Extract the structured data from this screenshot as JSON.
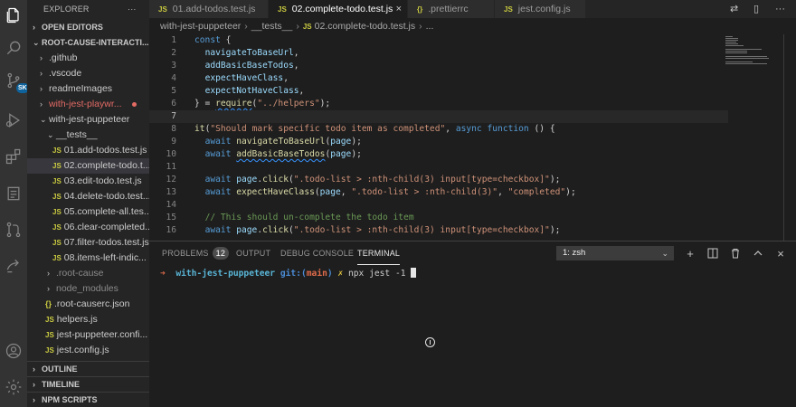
{
  "sidebar": {
    "title": "EXPLORER",
    "title_menu": "···",
    "open_editors": "OPEN EDITORS",
    "root": "ROOT-CAUSE-INTERACTI...",
    "items": [
      {
        "label": ".github",
        "kind": "folder"
      },
      {
        "label": ".vscode",
        "kind": "folder"
      },
      {
        "label": "readmeImages",
        "kind": "folder"
      },
      {
        "label": "with-jest-playwr...",
        "kind": "folder"
      },
      {
        "label": "with-jest-puppeteer",
        "kind": "folder-open"
      },
      {
        "label": "__tests__",
        "kind": "folder-open"
      },
      {
        "label": "01.add-todos.test.js",
        "kind": "js"
      },
      {
        "label": "02.complete-todo.t...",
        "kind": "js"
      },
      {
        "label": "03.edit-todo.test.js",
        "kind": "js"
      },
      {
        "label": "04.delete-todo.test...",
        "kind": "js"
      },
      {
        "label": "05.complete-all.tes...",
        "kind": "js"
      },
      {
        "label": "06.clear-completed...",
        "kind": "js"
      },
      {
        "label": "07.filter-todos.test.js",
        "kind": "js"
      },
      {
        "label": "08.items-left-indic...",
        "kind": "js"
      },
      {
        "label": ".root-cause",
        "kind": "folder"
      },
      {
        "label": "node_modules",
        "kind": "folder"
      },
      {
        "label": ".root-causerc.json",
        "kind": "json"
      },
      {
        "label": "helpers.js",
        "kind": "js"
      },
      {
        "label": "jest-puppeteer.confi...",
        "kind": "js"
      },
      {
        "label": "jest.config.js",
        "kind": "js"
      }
    ],
    "outline": "OUTLINE",
    "timeline": "TIMELINE",
    "npm_scripts": "NPM SCRIPTS"
  },
  "tabs": [
    {
      "label": "01.add-todos.test.js",
      "icon": "JS"
    },
    {
      "label": "02.complete-todo.test.js",
      "icon": "JS"
    },
    {
      "label": ".prettierrc",
      "icon": "{}"
    },
    {
      "label": "jest.config.js",
      "icon": "JS"
    }
  ],
  "tab_close": "×",
  "breadcrumb": {
    "folder1": "with-jest-puppeteer",
    "folder2": "__tests__",
    "file_icon": "JS",
    "file": "02.complete-todo.test.js",
    "tail": "..."
  },
  "editor_lines": [
    {
      "n": "1"
    },
    {
      "n": "2"
    },
    {
      "n": "3"
    },
    {
      "n": "4"
    },
    {
      "n": "5"
    },
    {
      "n": "6"
    },
    {
      "n": "7"
    },
    {
      "n": "8"
    },
    {
      "n": "9"
    },
    {
      "n": "10"
    },
    {
      "n": "11"
    },
    {
      "n": "12"
    },
    {
      "n": "13"
    },
    {
      "n": "14"
    },
    {
      "n": "15"
    },
    {
      "n": "16"
    }
  ],
  "code": {
    "l1_kw": "const",
    "l1_rest": " {",
    "l2": "navigateToBaseUrl",
    "l3": "addBasicBaseTodos",
    "l4": "expectHaveClass",
    "l5": "expectNotHaveClass",
    "l6_a": "} = ",
    "l6_fn": "require",
    "l6_s": "\"../helpers\"",
    "l8_fn": "it",
    "l8_s": "\"Should mark specific todo item as completed\"",
    "l8_kw1": "async",
    "l8_kw2": "function",
    "l8_end": " () {",
    "await": "await",
    "l9_fn": "navigateToBaseUrl",
    "l9_arg": "page",
    "l10_fn": "addBasicBaseTodos",
    "l10_arg": "page",
    "l12_obj": "page",
    "l12_fn": "click",
    "l12_s": "\".todo-list > :nth-child(3) input[type=checkbox]\"",
    "l13_fn": "expectHaveClass",
    "l13_arg": "page",
    "l13_s1": "\".todo-list > :nth-child(3)\"",
    "l13_s2": "\"completed\"",
    "l15_c": "// This should un-complete the todo item",
    "l16_s": "\".todo-list > :nth-child(3) input[type=checkbox]\""
  },
  "panel": {
    "problems": "PROBLEMS",
    "problems_count": "12",
    "output": "OUTPUT",
    "debug_console": "DEBUG CONSOLE",
    "terminal": "TERMINAL",
    "terminal_select": "1: zsh",
    "add_label": "+",
    "close_label": "×"
  },
  "terminal": {
    "arrow": "➜",
    "dir": "with-jest-puppeteer",
    "git": "git:(",
    "branch": "main",
    "git_end": ")",
    "dirty": "✗",
    "command": "npx jest -1"
  },
  "activity_badge": "SK"
}
